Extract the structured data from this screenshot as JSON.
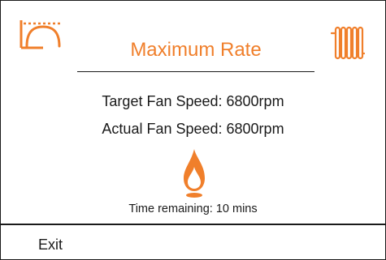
{
  "header": {
    "mode_icon": "heating-mode-arch-icon",
    "title": "Maximum Rate",
    "radiator_icon": "radiator-icon"
  },
  "status": {
    "target_fan_speed": "Target Fan Speed: 6800rpm",
    "actual_fan_speed": "Actual Fan Speed: 6800rpm",
    "flame_icon": "flame-icon",
    "time_remaining": "Time remaining: 10 mins"
  },
  "footer": {
    "exit_label": "Exit"
  },
  "colors": {
    "accent": "#f07f2b",
    "text": "#1a1a1a",
    "background": "#ffffff"
  }
}
